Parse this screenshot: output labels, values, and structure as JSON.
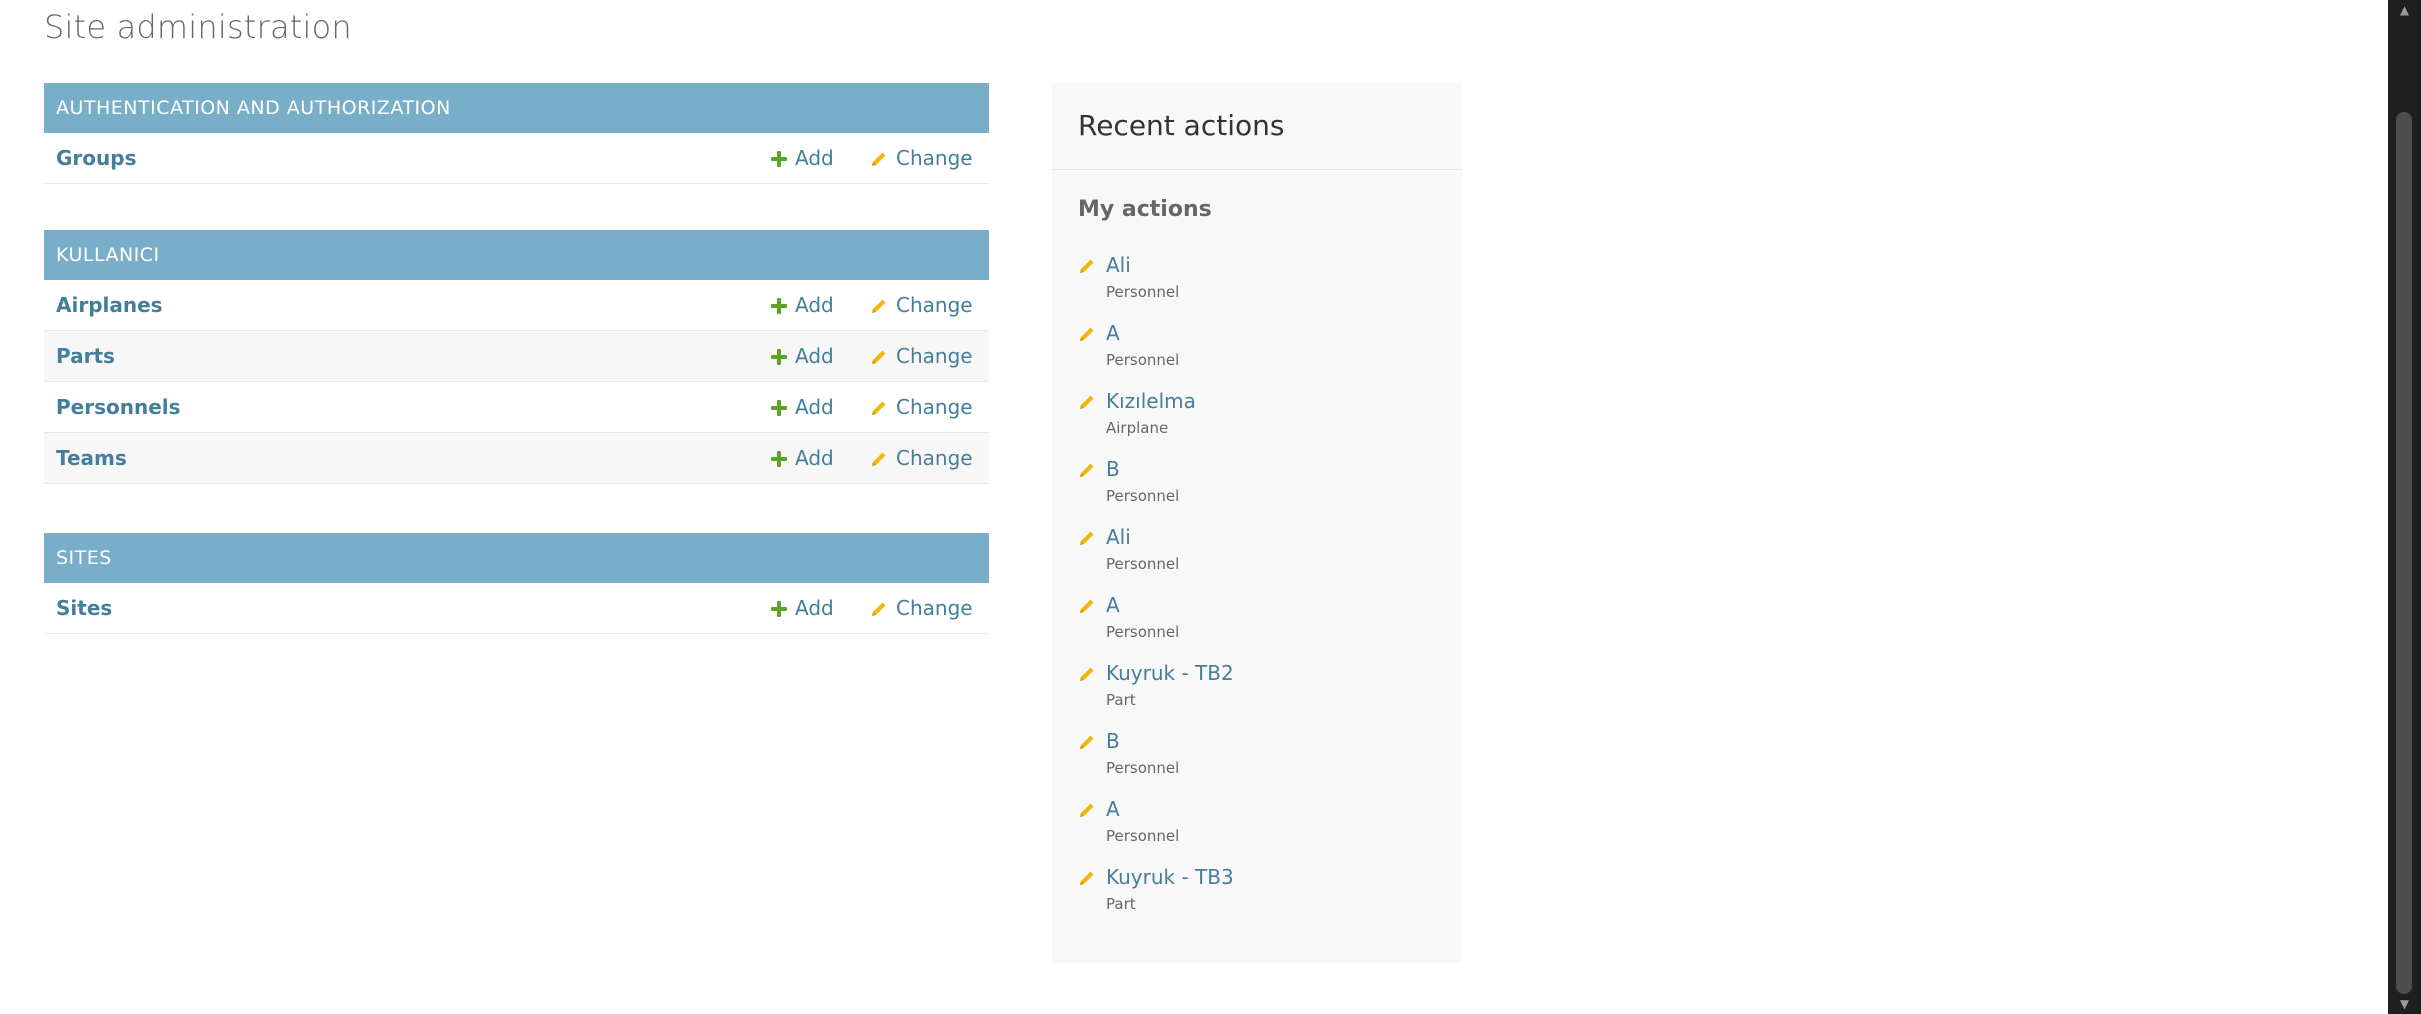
{
  "page": {
    "title": "Site administration"
  },
  "colors": {
    "caption_bg": "#79aec8",
    "link": "#447e9b",
    "add_icon": "#5ea22a",
    "change_icon": "#f0b90b",
    "recent_bg": "#f8f8f8"
  },
  "modules": [
    {
      "caption": "Authentication and Authorization",
      "models": [
        {
          "name": "Groups",
          "add": "Add",
          "change": "Change"
        }
      ]
    },
    {
      "caption": "Kullanici",
      "models": [
        {
          "name": "Airplanes",
          "add": "Add",
          "change": "Change"
        },
        {
          "name": "Parts",
          "add": "Add",
          "change": "Change"
        },
        {
          "name": "Personnels",
          "add": "Add",
          "change": "Change"
        },
        {
          "name": "Teams",
          "add": "Add",
          "change": "Change"
        }
      ]
    },
    {
      "caption": "Sites",
      "models": [
        {
          "name": "Sites",
          "add": "Add",
          "change": "Change"
        }
      ]
    }
  ],
  "icons": {
    "add": "plus-icon",
    "change": "pencil-icon",
    "scroll_up": "chevron-up-icon",
    "scroll_down": "chevron-down-icon"
  },
  "recent": {
    "title": "Recent actions",
    "subtitle": "My actions",
    "items": [
      {
        "label": "Ali",
        "type": "Personnel"
      },
      {
        "label": "A",
        "type": "Personnel"
      },
      {
        "label": "Kızılelma",
        "type": "Airplane"
      },
      {
        "label": "B",
        "type": "Personnel"
      },
      {
        "label": "Ali",
        "type": "Personnel"
      },
      {
        "label": "A",
        "type": "Personnel"
      },
      {
        "label": "Kuyruk - TB2",
        "type": "Part"
      },
      {
        "label": "B",
        "type": "Personnel"
      },
      {
        "label": "A",
        "type": "Personnel"
      },
      {
        "label": "Kuyruk - TB3",
        "type": "Part"
      }
    ]
  }
}
